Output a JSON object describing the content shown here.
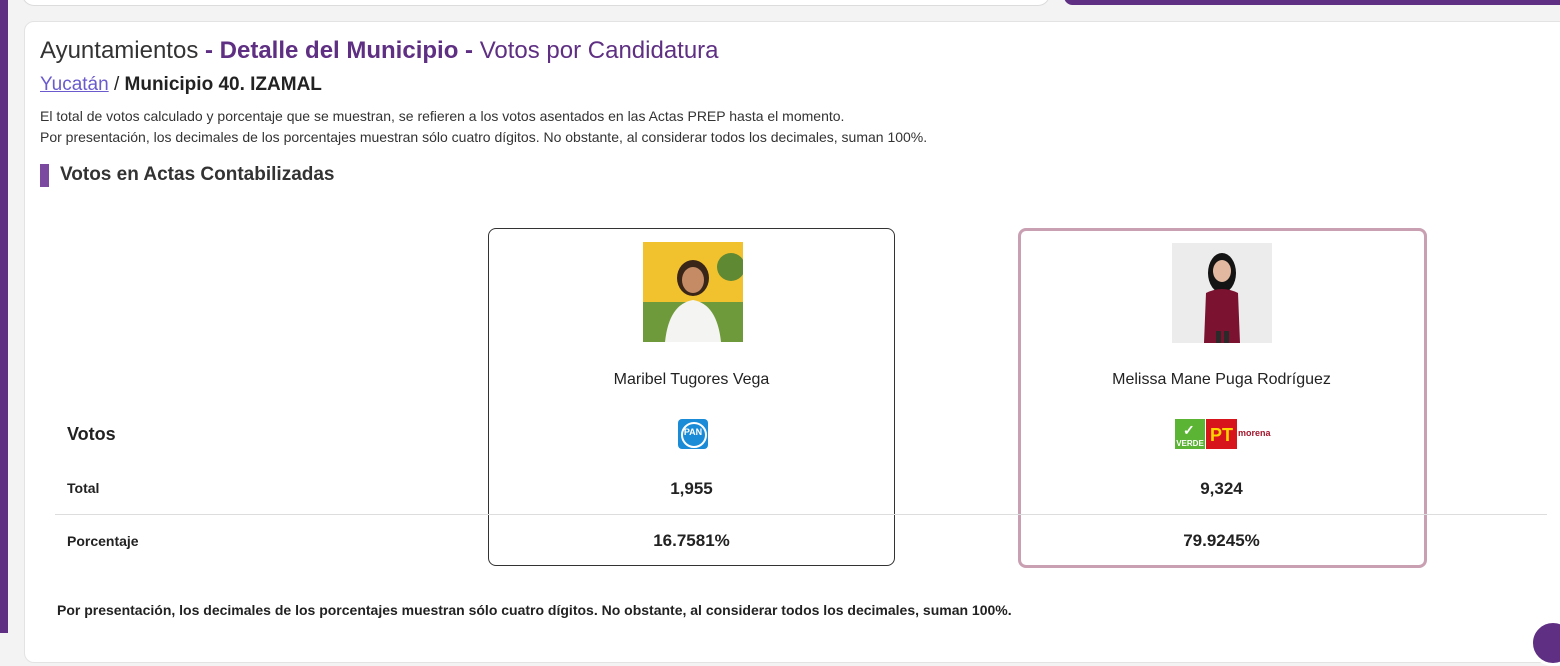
{
  "header": {
    "title_part1": "Ayuntamientos",
    "title_sep1": " - ",
    "title_part2": "Detalle del Municipio",
    "title_sep2": " - ",
    "title_part3": "Votos por Candidatura"
  },
  "breadcrumb": {
    "state_link": "Yucatán",
    "separator": " / ",
    "municipality": "Municipio 40. IZAMAL"
  },
  "notes": {
    "line1": "El total de votos calculado y porcentaje que se muestran, se refieren a los votos asentados en las Actas PREP hasta el momento.",
    "line2": "Por presentación, los decimales de los porcentajes muestran sólo cuatro dígitos. No obstante, al considerar todos los decimales, suman 100%."
  },
  "section": {
    "title": "Votos en Actas Contabilizadas"
  },
  "row_labels": {
    "votos": "Votos",
    "total": "Total",
    "porcentaje": "Porcentaje"
  },
  "candidates": [
    {
      "name": "Maribel Tugores Vega",
      "party": "PAN",
      "party_logo_text": "PAN",
      "total": "1,955",
      "porcentaje": "16.7581%",
      "highlight_color": "#333333"
    },
    {
      "name": "Melissa Mane Puga Rodríguez",
      "party": "VERDE-PT-morena",
      "party_logo_text": {
        "verde": "VERDE",
        "pt": "PT",
        "morena": "morena"
      },
      "total": "9,324",
      "porcentaje": "79.9245%",
      "highlight_color": "#c9a0b2"
    }
  ],
  "footnote": "Por presentación, los decimales de los porcentajes muestran sólo cuatro dígitos. No obstante, al considerar todos los decimales, suman 100%.",
  "colors": {
    "brand_purple": "#5e2f82",
    "link": "#6a5acd",
    "pan_blue": "#1a8bd6",
    "verde": "#5bb434",
    "pt_red": "#d7141b",
    "morena": "#a5162c"
  }
}
